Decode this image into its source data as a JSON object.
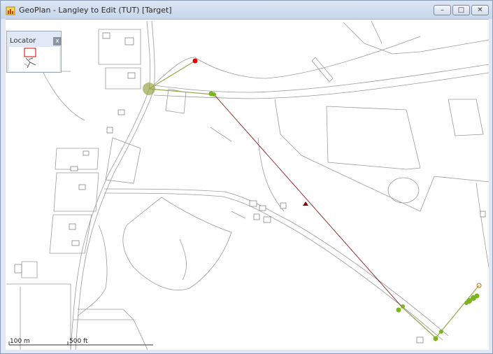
{
  "window": {
    "title": "GeoPlan - Langley to Edit (TUT) [Target]"
  },
  "controls": {
    "minimize": "–",
    "maximize": "□",
    "close": "✕"
  },
  "locator": {
    "title": "Locator",
    "close_label": "x"
  },
  "scale": {
    "metric_label": "100 m",
    "imperial_label": "500 ft"
  },
  "colors": {
    "route_line": "#8a1a1a",
    "route_marker": "#8b0000",
    "green_node": "#7ab51d",
    "red_node": "#e00000",
    "link_line": "#9aa54a"
  }
}
